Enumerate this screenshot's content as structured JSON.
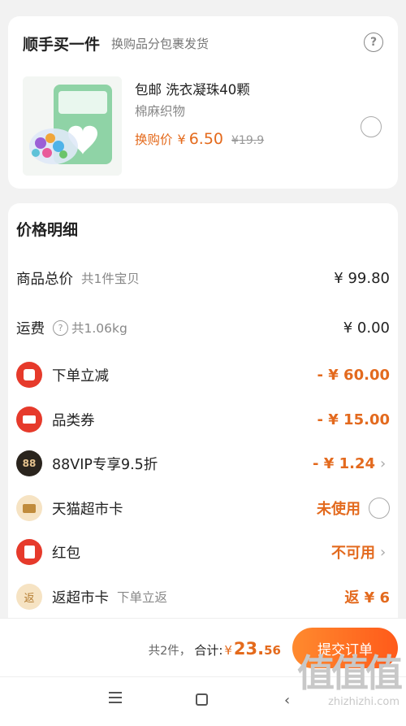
{
  "addon": {
    "title": "顺手买一件",
    "subtitle": "换购品分包裹发货",
    "help": "?",
    "product": {
      "name": "包邮 洗衣凝珠40颗",
      "sku": "棉麻织物",
      "price_label": "换购价",
      "yen": "¥",
      "price": "6.50",
      "original_price": "¥19.9"
    }
  },
  "price_detail": {
    "title": "价格明细",
    "goods_total": {
      "label": "商品总价",
      "sub": "共1件宝贝",
      "value": "¥ 99.80"
    },
    "shipping": {
      "label": "运费",
      "sub": "共1.06kg",
      "help": "?",
      "value": "¥ 0.00"
    },
    "order_discount": {
      "label": "下单立减",
      "value": "- ¥ 60.00"
    },
    "category_coupon": {
      "label": "品类券",
      "value": "- ¥ 15.00"
    },
    "vip": {
      "badge": "88",
      "label": "88VIP专享9.5折",
      "value": "- ¥ 1.24",
      "chevron": "›"
    },
    "tmall_card": {
      "label": "天猫超市卡",
      "value": "未使用"
    },
    "red_packet": {
      "label": "红包",
      "value": "不可用",
      "chevron": "›"
    },
    "cashback": {
      "badge": "返",
      "label": "返超市卡",
      "sub": "下单立返",
      "value": "返 ¥ 6"
    }
  },
  "footer": {
    "count": "共2件，",
    "total_label": "合计:",
    "yen": "¥",
    "total_int": "23.",
    "total_dec": "56",
    "submit": "提交订单"
  },
  "watermark": {
    "glyphs": "值值值",
    "url": "zhizhizhi.com"
  },
  "colors": {
    "accent": "#e46a1c",
    "red": "#e63a2b",
    "background": "#f2f2f2"
  }
}
